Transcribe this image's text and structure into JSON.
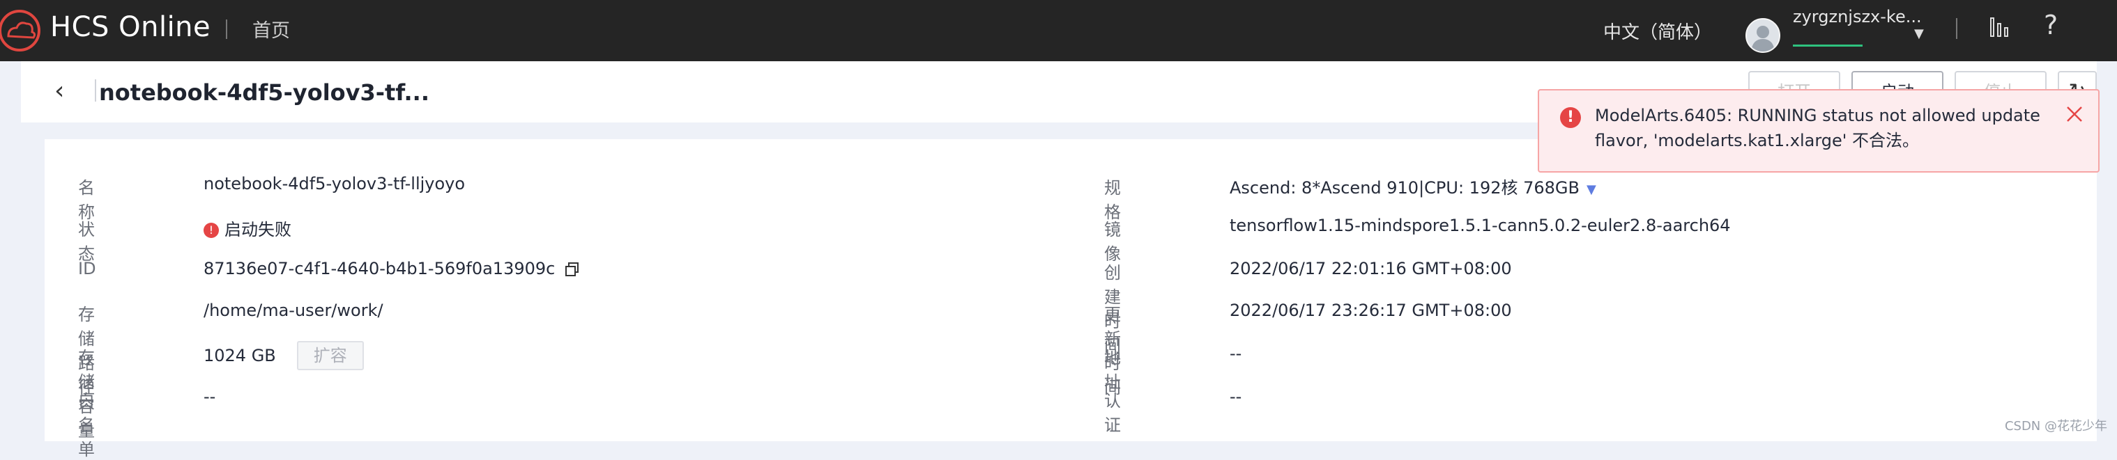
{
  "topbar": {
    "brand": "HCS Online",
    "home": "首页",
    "language": "中文（简体）",
    "username": "zyrgznjszx-ke..."
  },
  "header": {
    "title": "notebook-4df5-yolov3-tf...",
    "open_label": "打开",
    "start_label": "启动",
    "stop_label": "停止"
  },
  "left_details": [
    {
      "label": "名称",
      "value": "notebook-4df5-yolov3-tf-lljyoyo"
    },
    {
      "label": "状态",
      "value": "启动失败"
    },
    {
      "label": "ID",
      "value": "87136e07-c4f1-4640-b4b1-569f0a13909c"
    },
    {
      "label": "存储路径",
      "value": "/home/ma-user/work/"
    },
    {
      "label": "存储容量",
      "value": "1024 GB",
      "action": "扩容"
    },
    {
      "label": "白名单",
      "value": "--"
    }
  ],
  "right_details": [
    {
      "label": "规格",
      "value": "Ascend: 8*Ascend 910|CPU: 192核 768GB"
    },
    {
      "label": "镜像",
      "value": "tensorflow1.15-mindspore1.5.1-cann5.0.2-euler2.8-aarch64"
    },
    {
      "label": "创建时间",
      "value": "2022/06/17 22:01:16 GMT+08:00"
    },
    {
      "label": "更新时间",
      "value": "2022/06/17 23:26:17 GMT+08:00"
    },
    {
      "label": "地址",
      "value": "--"
    },
    {
      "label": "认证",
      "value": "--"
    }
  ],
  "toast": {
    "message_line1": "ModelArts.6405: RUNNING status not allowed update",
    "message_line2": "flavor, 'modelarts.kat1.xlarge' 不合法。"
  },
  "watermark": "CSDN @花花少年",
  "colors": {
    "topbar": "#252525",
    "error": "#e54545",
    "accent": "#5e7ce0",
    "success": "#2ec27e"
  }
}
